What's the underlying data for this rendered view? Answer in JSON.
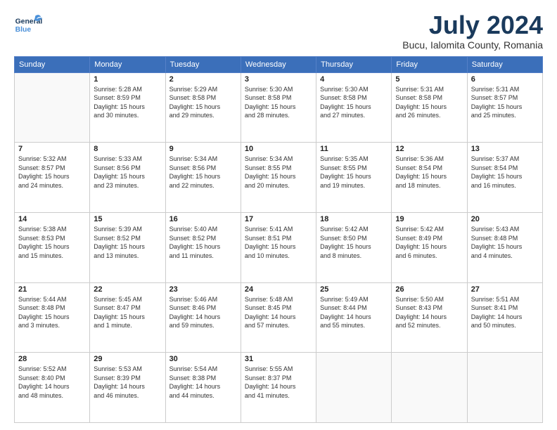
{
  "header": {
    "logo_general": "General",
    "logo_blue": "Blue",
    "month_title": "July 2024",
    "location": "Bucu, Ialomita County, Romania"
  },
  "weekdays": [
    "Sunday",
    "Monday",
    "Tuesday",
    "Wednesday",
    "Thursday",
    "Friday",
    "Saturday"
  ],
  "weeks": [
    [
      {
        "day": "",
        "info": ""
      },
      {
        "day": "1",
        "info": "Sunrise: 5:28 AM\nSunset: 8:59 PM\nDaylight: 15 hours\nand 30 minutes."
      },
      {
        "day": "2",
        "info": "Sunrise: 5:29 AM\nSunset: 8:58 PM\nDaylight: 15 hours\nand 29 minutes."
      },
      {
        "day": "3",
        "info": "Sunrise: 5:30 AM\nSunset: 8:58 PM\nDaylight: 15 hours\nand 28 minutes."
      },
      {
        "day": "4",
        "info": "Sunrise: 5:30 AM\nSunset: 8:58 PM\nDaylight: 15 hours\nand 27 minutes."
      },
      {
        "day": "5",
        "info": "Sunrise: 5:31 AM\nSunset: 8:58 PM\nDaylight: 15 hours\nand 26 minutes."
      },
      {
        "day": "6",
        "info": "Sunrise: 5:31 AM\nSunset: 8:57 PM\nDaylight: 15 hours\nand 25 minutes."
      }
    ],
    [
      {
        "day": "7",
        "info": "Sunrise: 5:32 AM\nSunset: 8:57 PM\nDaylight: 15 hours\nand 24 minutes."
      },
      {
        "day": "8",
        "info": "Sunrise: 5:33 AM\nSunset: 8:56 PM\nDaylight: 15 hours\nand 23 minutes."
      },
      {
        "day": "9",
        "info": "Sunrise: 5:34 AM\nSunset: 8:56 PM\nDaylight: 15 hours\nand 22 minutes."
      },
      {
        "day": "10",
        "info": "Sunrise: 5:34 AM\nSunset: 8:55 PM\nDaylight: 15 hours\nand 20 minutes."
      },
      {
        "day": "11",
        "info": "Sunrise: 5:35 AM\nSunset: 8:55 PM\nDaylight: 15 hours\nand 19 minutes."
      },
      {
        "day": "12",
        "info": "Sunrise: 5:36 AM\nSunset: 8:54 PM\nDaylight: 15 hours\nand 18 minutes."
      },
      {
        "day": "13",
        "info": "Sunrise: 5:37 AM\nSunset: 8:54 PM\nDaylight: 15 hours\nand 16 minutes."
      }
    ],
    [
      {
        "day": "14",
        "info": "Sunrise: 5:38 AM\nSunset: 8:53 PM\nDaylight: 15 hours\nand 15 minutes."
      },
      {
        "day": "15",
        "info": "Sunrise: 5:39 AM\nSunset: 8:52 PM\nDaylight: 15 hours\nand 13 minutes."
      },
      {
        "day": "16",
        "info": "Sunrise: 5:40 AM\nSunset: 8:52 PM\nDaylight: 15 hours\nand 11 minutes."
      },
      {
        "day": "17",
        "info": "Sunrise: 5:41 AM\nSunset: 8:51 PM\nDaylight: 15 hours\nand 10 minutes."
      },
      {
        "day": "18",
        "info": "Sunrise: 5:42 AM\nSunset: 8:50 PM\nDaylight: 15 hours\nand 8 minutes."
      },
      {
        "day": "19",
        "info": "Sunrise: 5:42 AM\nSunset: 8:49 PM\nDaylight: 15 hours\nand 6 minutes."
      },
      {
        "day": "20",
        "info": "Sunrise: 5:43 AM\nSunset: 8:48 PM\nDaylight: 15 hours\nand 4 minutes."
      }
    ],
    [
      {
        "day": "21",
        "info": "Sunrise: 5:44 AM\nSunset: 8:48 PM\nDaylight: 15 hours\nand 3 minutes."
      },
      {
        "day": "22",
        "info": "Sunrise: 5:45 AM\nSunset: 8:47 PM\nDaylight: 15 hours\nand 1 minute."
      },
      {
        "day": "23",
        "info": "Sunrise: 5:46 AM\nSunset: 8:46 PM\nDaylight: 14 hours\nand 59 minutes."
      },
      {
        "day": "24",
        "info": "Sunrise: 5:48 AM\nSunset: 8:45 PM\nDaylight: 14 hours\nand 57 minutes."
      },
      {
        "day": "25",
        "info": "Sunrise: 5:49 AM\nSunset: 8:44 PM\nDaylight: 14 hours\nand 55 minutes."
      },
      {
        "day": "26",
        "info": "Sunrise: 5:50 AM\nSunset: 8:43 PM\nDaylight: 14 hours\nand 52 minutes."
      },
      {
        "day": "27",
        "info": "Sunrise: 5:51 AM\nSunset: 8:41 PM\nDaylight: 14 hours\nand 50 minutes."
      }
    ],
    [
      {
        "day": "28",
        "info": "Sunrise: 5:52 AM\nSunset: 8:40 PM\nDaylight: 14 hours\nand 48 minutes."
      },
      {
        "day": "29",
        "info": "Sunrise: 5:53 AM\nSunset: 8:39 PM\nDaylight: 14 hours\nand 46 minutes."
      },
      {
        "day": "30",
        "info": "Sunrise: 5:54 AM\nSunset: 8:38 PM\nDaylight: 14 hours\nand 44 minutes."
      },
      {
        "day": "31",
        "info": "Sunrise: 5:55 AM\nSunset: 8:37 PM\nDaylight: 14 hours\nand 41 minutes."
      },
      {
        "day": "",
        "info": ""
      },
      {
        "day": "",
        "info": ""
      },
      {
        "day": "",
        "info": ""
      }
    ]
  ]
}
